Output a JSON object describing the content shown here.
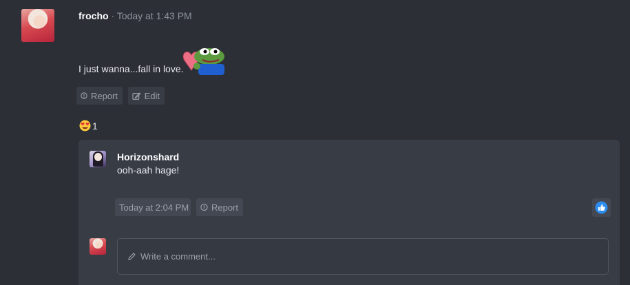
{
  "post": {
    "author": "frocho",
    "separator": "·",
    "timestamp": "Today at 1:43 PM",
    "text": "I just wanna...fall in love.",
    "emote_icon": "pepe-heart-emote",
    "actions": {
      "report_label": "Report",
      "edit_label": "Edit"
    },
    "reaction": {
      "icon": "heart-eyes-emoji",
      "count": "1"
    }
  },
  "reply": {
    "author": "Horizonshard",
    "text": "ooh-aah hage!",
    "timestamp": "Today at 2:04 PM",
    "report_label": "Report",
    "like_icon": "thumbs-up-icon"
  },
  "comment_input": {
    "placeholder": "Write a comment...",
    "icon": "pencil-icon"
  },
  "colors": {
    "background": "#2c2f36",
    "panel": "#383c45",
    "like_blue": "#2d8cf0"
  }
}
